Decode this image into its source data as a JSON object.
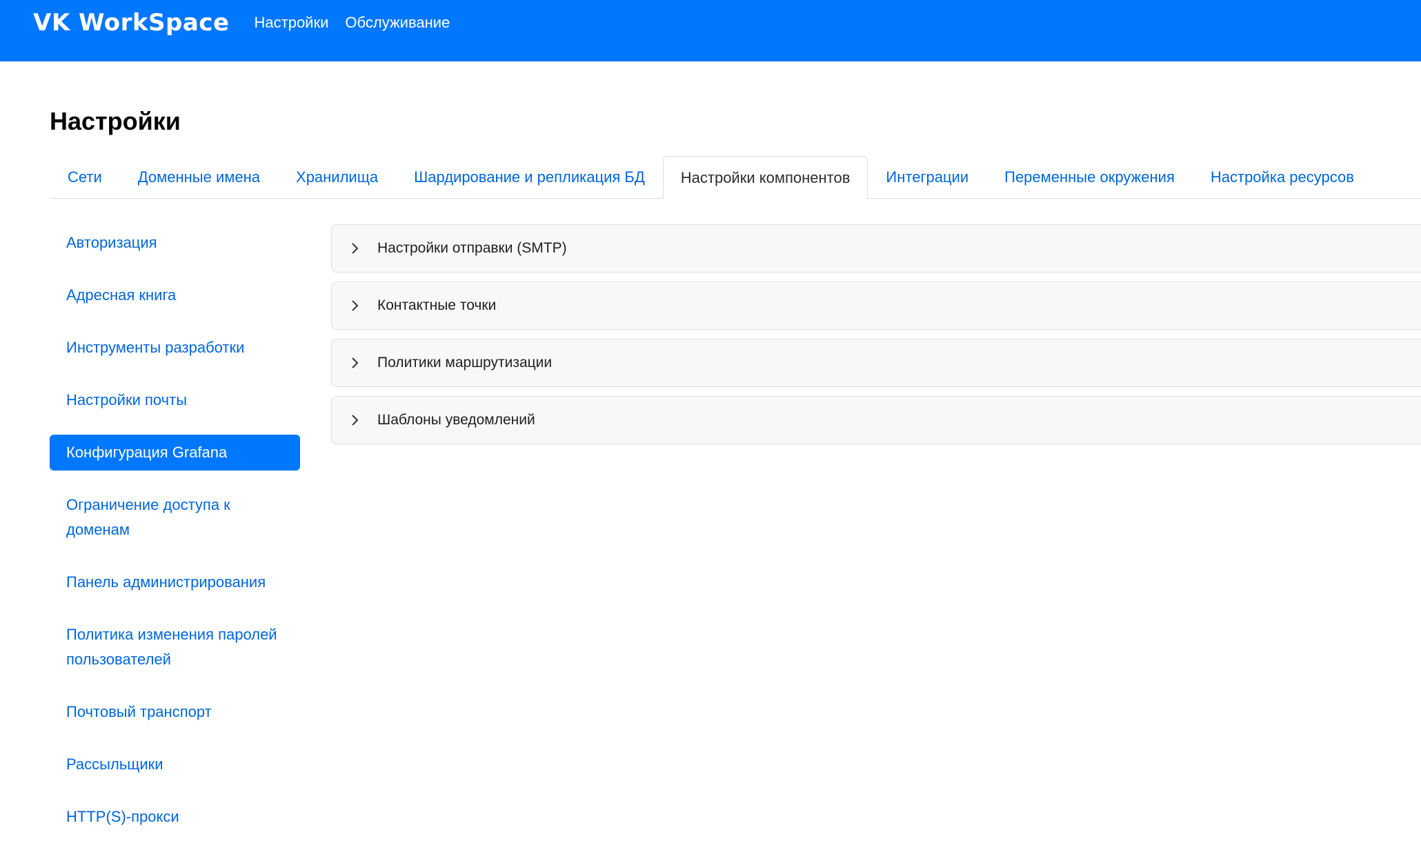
{
  "header": {
    "logo": "VK WorkSpace",
    "nav": [
      {
        "label": "Настройки"
      },
      {
        "label": "Обслуживание"
      }
    ]
  },
  "page": {
    "title": "Настройки"
  },
  "tabs": [
    {
      "label": "Сети"
    },
    {
      "label": "Доменные имена"
    },
    {
      "label": "Хранилища"
    },
    {
      "label": "Шардирование и репликация БД"
    },
    {
      "label": "Настройки компонентов",
      "active": true
    },
    {
      "label": "Интеграции"
    },
    {
      "label": "Переменные окружения"
    },
    {
      "label": "Настройка ресурсов"
    }
  ],
  "sidebar": {
    "items": [
      {
        "label": "Авторизация"
      },
      {
        "label": "Адресная книга"
      },
      {
        "label": "Инструменты разработки"
      },
      {
        "label": "Настройки почты"
      },
      {
        "label": "Конфигурация Grafana",
        "active": true
      },
      {
        "label": "Ограничение доступа к доменам"
      },
      {
        "label": "Панель администрирования"
      },
      {
        "label": "Политика изменения паролей пользователей"
      },
      {
        "label": "Почтовый транспорт"
      },
      {
        "label": "Рассыльщики"
      },
      {
        "label": "HTTP(S)-прокси"
      }
    ]
  },
  "accordion": {
    "icon": "chevron-right-icon",
    "items": [
      {
        "label": "Настройки отправки (SMTP)"
      },
      {
        "label": "Контактные точки"
      },
      {
        "label": "Политики маршрутизации"
      },
      {
        "label": "Шаблоны уведомлений"
      }
    ]
  },
  "colors": {
    "brand": "#0077ff",
    "link": "#0066dd"
  }
}
